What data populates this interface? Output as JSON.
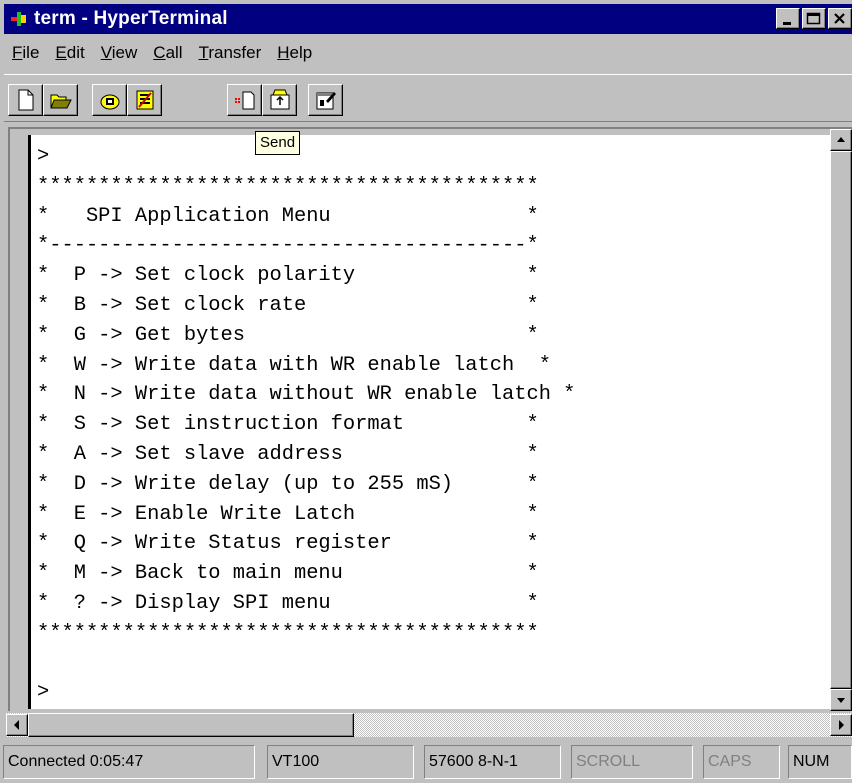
{
  "window": {
    "title": "term - HyperTerminal"
  },
  "menu": [
    "File",
    "Edit",
    "View",
    "Call",
    "Transfer",
    "Help"
  ],
  "toolbar": {
    "tooltip": "Send",
    "buttons": [
      "new-icon",
      "open-icon",
      "call-icon",
      "disconnect-icon",
      "receive-icon",
      "send-icon",
      "properties-icon"
    ]
  },
  "terminal": {
    "lines": [
      ">",
      "*****************************************",
      "*   SPI Application Menu                *",
      "*---------------------------------------*",
      "*  P -> Set clock polarity              *",
      "*  B -> Set clock rate                  *",
      "*  G -> Get bytes                       *",
      "*  W -> Write data with WR enable latch  *",
      "*  N -> Write data without WR enable latch *",
      "*  S -> Set instruction format          *",
      "*  A -> Set slave address               *",
      "*  D -> Write delay (up to 255 mS)      *",
      "*  E -> Enable Write Latch              *",
      "*  Q -> Write Status register           *",
      "*  M -> Back to main menu               *",
      "*  ? -> Display SPI menu                *",
      "*****************************************",
      "",
      ">"
    ]
  },
  "status": {
    "connected": "Connected 0:05:47",
    "emulation": "VT100",
    "settings": "57600 8-N-1",
    "scroll": "SCROLL",
    "caps": "CAPS",
    "num": "NUM"
  },
  "colors": {
    "titlebar": "#000080",
    "face": "#c0c0c0",
    "tooltip": "#ffffe1"
  }
}
